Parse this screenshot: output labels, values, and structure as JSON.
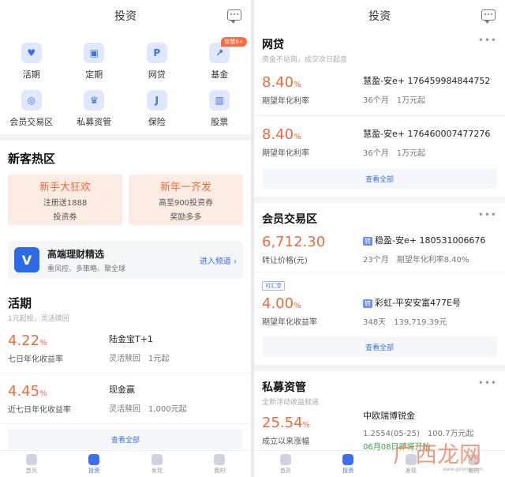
{
  "left": {
    "title": "投资",
    "grid": [
      {
        "label": "活期",
        "icon": "piggy-bank-icon",
        "glyph": "♥"
      },
      {
        "label": "定期",
        "icon": "lock-icon",
        "glyph": "▣"
      },
      {
        "label": "网贷",
        "icon": "shield-p-icon",
        "glyph": "P"
      },
      {
        "label": "基金",
        "icon": "chart-icon",
        "glyph": "↗",
        "badge": "智慧6+"
      },
      {
        "label": "会员交易区",
        "icon": "refresh-icon",
        "glyph": "◎"
      },
      {
        "label": "私募资管",
        "icon": "trophy-icon",
        "glyph": "♛"
      },
      {
        "label": "保险",
        "icon": "umbrella-icon",
        "glyph": "J"
      },
      {
        "label": "股票",
        "icon": "candlestick-icon",
        "glyph": "▥"
      }
    ],
    "newcomer": {
      "title": "新客热区",
      "promos": [
        {
          "title": "新手大狂欢",
          "line1": "注册送1888",
          "line2": "投资券"
        },
        {
          "title": "新年一齐发",
          "line1": "高至900投资券",
          "line2": "奖励多多"
        }
      ]
    },
    "banner": {
      "logo": "V",
      "title": "高端理财精选",
      "sub": "重风控、多策略、聚全球",
      "link": "进入频道"
    },
    "current": {
      "title": "活期",
      "sub": "1元起投，灵活赎回",
      "products": [
        {
          "rate": "4.22",
          "unit": "%",
          "rate_label": "七日年化收益率",
          "name": "陆金宝T+1",
          "d1": "灵活赎回",
          "d2": "1元起"
        },
        {
          "rate": "4.45",
          "unit": "%",
          "rate_label": "近七日年化收益率",
          "name": "现金赢",
          "d1": "灵活赎回",
          "d2": "1,000元起"
        }
      ],
      "view_all": "查看全部"
    },
    "tabs": [
      {
        "label": "首页"
      },
      {
        "label": "投资"
      },
      {
        "label": "发现"
      },
      {
        "label": "我的"
      }
    ]
  },
  "right": {
    "title": "投资",
    "p2p": {
      "title": "网贷",
      "sub": "资金不站岗，成交次日起息",
      "products": [
        {
          "rate": "8.40",
          "unit": "%",
          "rate_label": "期望年化利率",
          "name": "慧盈-安e+ 176459984844752",
          "d1": "36个月",
          "d2": "1万元起"
        },
        {
          "rate": "8.40",
          "unit": "%",
          "rate_label": "期望年化利率",
          "name": "慧盈-安e+ 176460007477276",
          "d1": "36个月",
          "d2": "1万元起"
        }
      ],
      "view_all": "查看全部"
    },
    "member": {
      "title": "会员交易区",
      "products": [
        {
          "rate": "6,712.30",
          "unit": "",
          "rate_label": "转让价格(元)",
          "tag": "转",
          "name": "稳盈-安e+ 180531006676",
          "d1": "23个月",
          "d2": "期望年化利率8.40%"
        },
        {
          "badge": "可汇享",
          "rate": "4.00",
          "unit": "%",
          "rate_label": "期望年化收益率",
          "tag": "转",
          "name": "彩虹-平安安富477E号",
          "d1": "348天",
          "d2": "139,719.39元"
        }
      ],
      "view_all": "查看全部"
    },
    "private": {
      "title": "私募资管",
      "sub": "全新浮动收益频道",
      "products": [
        {
          "rate": "25.54",
          "unit": "%",
          "rate_label": "成立以来涨幅",
          "name": "中欧瑞博锐金",
          "d1": "1.2554(05-25)",
          "d2": "100.7万元起",
          "date": "06月08日即将开始"
        }
      ]
    },
    "tabs": [
      {
        "label": "首页"
      },
      {
        "label": "投资"
      },
      {
        "label": "发现"
      },
      {
        "label": "我的"
      }
    ],
    "watermark": "广西龙网",
    "watermark_sub": "www.gxlong.com"
  },
  "colors": {
    "accent": "#3b6ff0",
    "rate": "#f06a3a",
    "green": "#3aa648"
  }
}
